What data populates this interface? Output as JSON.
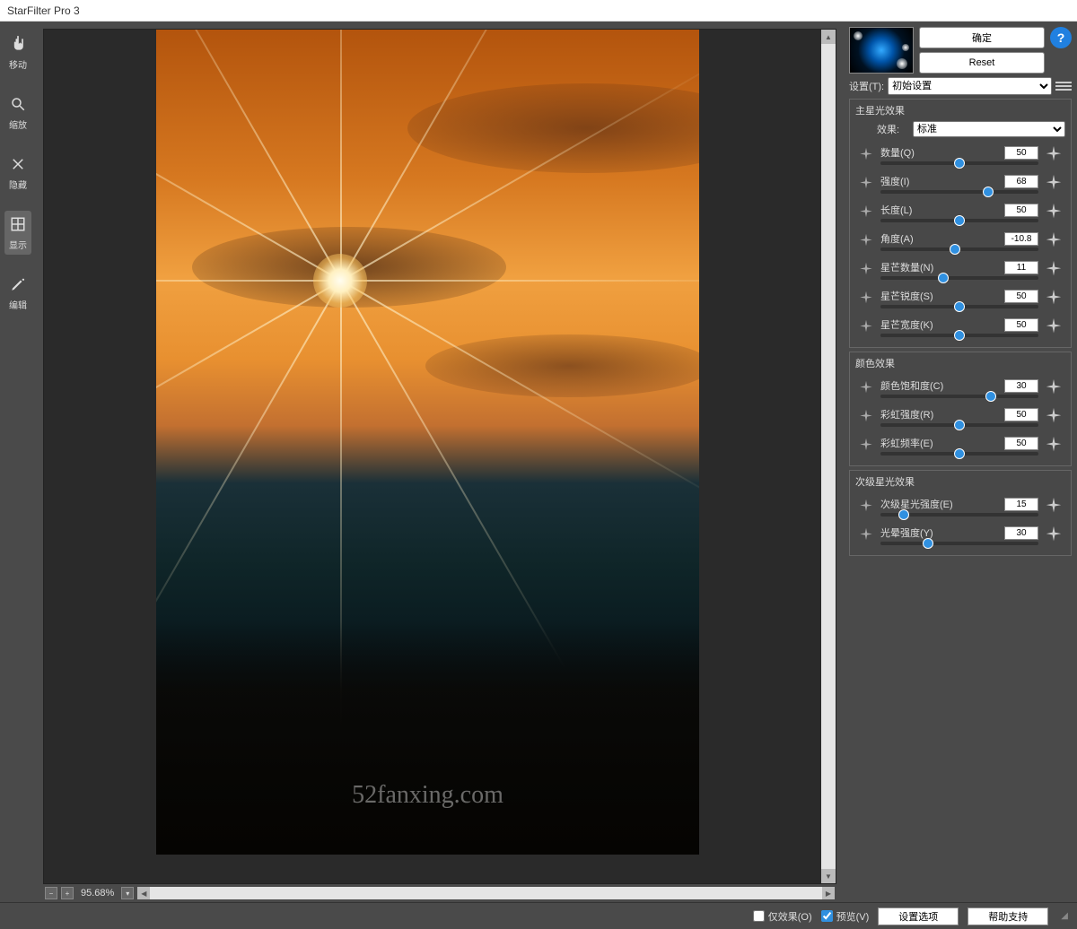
{
  "title": "StarFilter Pro 3",
  "tools": [
    {
      "id": "move",
      "label": "移动"
    },
    {
      "id": "zoom",
      "label": "缩放"
    },
    {
      "id": "hide",
      "label": "隐藏"
    },
    {
      "id": "show",
      "label": "显示"
    },
    {
      "id": "edit",
      "label": "编辑"
    }
  ],
  "zoom": "95.68%",
  "watermark": "52fanxing.com",
  "buttons": {
    "ok": "确定",
    "reset": "Reset"
  },
  "help": "?",
  "settings_label": "设置(T):",
  "settings_value": "初始设置",
  "groups": {
    "main": {
      "title": "主星光效果",
      "effect_label": "效果:",
      "effect_value": "标准",
      "sliders": [
        {
          "label": "数量(Q)",
          "value": "50",
          "pos": 50
        },
        {
          "label": "强度(I)",
          "value": "68",
          "pos": 68
        },
        {
          "label": "长度(L)",
          "value": "50",
          "pos": 50
        },
        {
          "label": "角度(A)",
          "value": "-10.8",
          "pos": 47
        },
        {
          "label": "星芒数量(N)",
          "value": "11",
          "pos": 40
        },
        {
          "label": "星芒锐度(S)",
          "value": "50",
          "pos": 50
        },
        {
          "label": "星芒宽度(K)",
          "value": "50",
          "pos": 50
        }
      ]
    },
    "color": {
      "title": "颜色效果",
      "sliders": [
        {
          "label": "颜色饱和度(C)",
          "value": "30",
          "pos": 70
        },
        {
          "label": "彩虹强度(R)",
          "value": "50",
          "pos": 50
        },
        {
          "label": "彩虹频率(E)",
          "value": "50",
          "pos": 50
        }
      ]
    },
    "secondary": {
      "title": "次级星光效果",
      "sliders": [
        {
          "label": "次级星光强度(E)",
          "value": "15",
          "pos": 15
        },
        {
          "label": "光晕强度(Y)",
          "value": "30",
          "pos": 30
        }
      ]
    }
  },
  "bottom": {
    "only_effect": "仅效果(O)",
    "preview": "预览(V)",
    "options": "设置选项",
    "support": "帮助支持"
  }
}
